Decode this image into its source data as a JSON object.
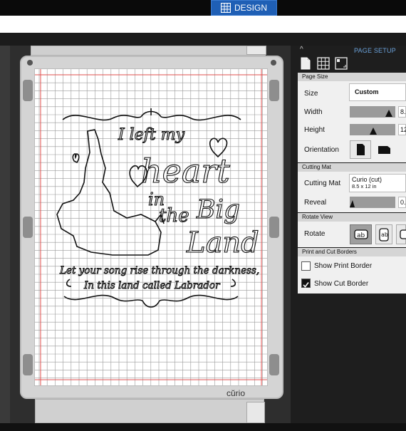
{
  "topbar": {
    "design_tab_label": "DESIGN"
  },
  "mat": {
    "brand_label": "cŭrio"
  },
  "design_text": {
    "line1": "I left my",
    "line2": "heart",
    "line3": "in",
    "line4": "the",
    "line5": "Big",
    "line6": "Land",
    "line7": "Let your song rise through the darkness,",
    "line8": "In this land called Labrador"
  },
  "panel": {
    "title": "PAGE SETUP",
    "page_size": {
      "header": "Page Size",
      "size_label": "Size",
      "size_value": "Custom",
      "width_label": "Width",
      "width_value": "8.",
      "height_label": "Height",
      "height_value": "12",
      "orientation_label": "Orientation"
    },
    "cutting_mat": {
      "header": "Cutting Mat",
      "mat_label": "Cutting Mat",
      "mat_value": "Curio (cut)",
      "mat_size": "8.5 x 12 in",
      "reveal_label": "Reveal",
      "reveal_value": "0."
    },
    "rotate_view": {
      "header": "Rotate View",
      "rotate_label": "Rotate"
    },
    "borders": {
      "header": "Print and Cut Borders",
      "print_border_label": "Show Print Border",
      "print_border_checked": false,
      "cut_border_label": "Show Cut Border",
      "cut_border_checked": true
    }
  },
  "colors": {
    "accent_blue": "#1f5fb5",
    "panel_dark": "#1e1e1e",
    "grid_line": "#9a9a9a",
    "margin_red": "#e0504f"
  }
}
